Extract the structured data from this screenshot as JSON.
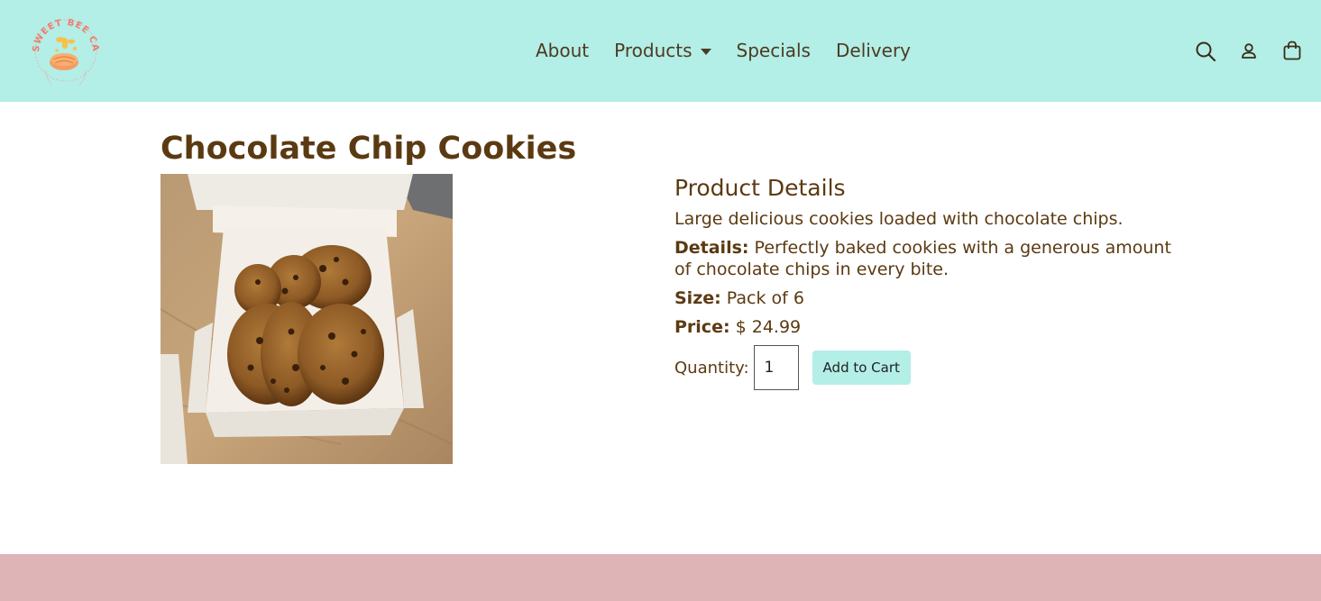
{
  "header": {
    "logo_alt": "SWEET BEE CAKES",
    "nav": {
      "about": "About",
      "products": "Products",
      "specials": "Specials",
      "delivery": "Delivery"
    },
    "icons": [
      "search-icon",
      "user-icon",
      "shopping-bag-icon"
    ]
  },
  "product": {
    "title": "Chocolate Chip Cookies",
    "image_alt": "Chocolate Chip Cookies",
    "details_heading": "Product Details",
    "description": "Large delicious cookies loaded with chocolate chips.",
    "details_label": "Details:",
    "details_text": " Perfectly baked cookies with a generous amount of chocolate chips in every bite.",
    "size_label": "Size:",
    "size_value": " Pack of 6",
    "price_label": "Price:",
    "price_value": " $ 24.99",
    "quantity_label": "Quantity:",
    "quantity_value": "1",
    "add_to_cart": "Add to Cart"
  },
  "colors": {
    "header_bg": "#b3eee7",
    "footer_bg": "#deb4b6",
    "text_brown": "#5b3a12",
    "button_bg": "#b3eee7"
  }
}
